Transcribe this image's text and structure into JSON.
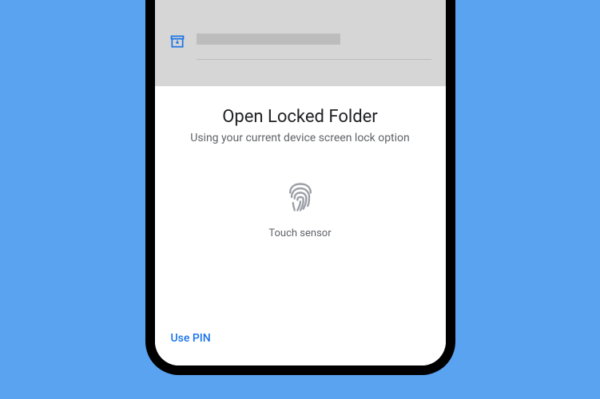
{
  "sheet": {
    "title": "Open Locked Folder",
    "subtitle": "Using your current device screen lock option",
    "touch_sensor_label": "Touch sensor",
    "use_pin_label": "Use PIN"
  },
  "icons": {
    "archive": "archive-box-icon",
    "fingerprint": "fingerprint-icon"
  },
  "colors": {
    "background": "#5aa3f0",
    "accent": "#1a73e8",
    "text_primary": "#202124",
    "text_secondary": "#5f6368"
  }
}
